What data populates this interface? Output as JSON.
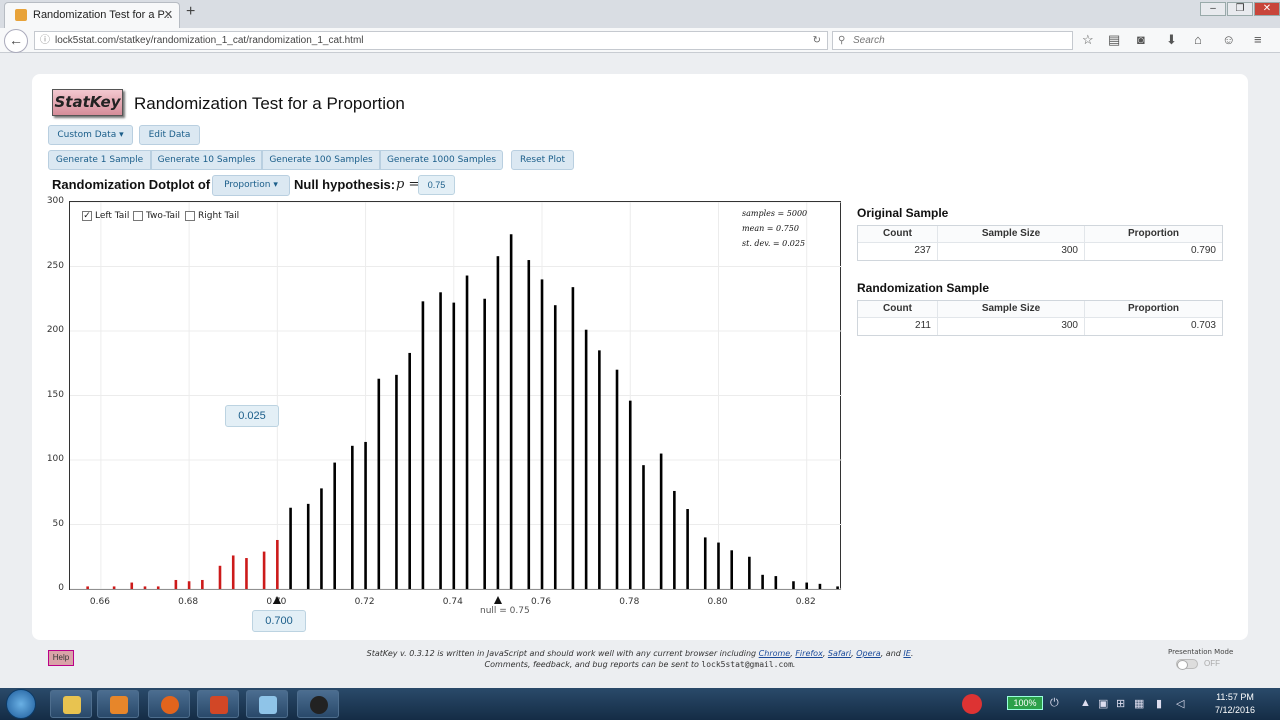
{
  "browser": {
    "tab_title": "Randomization Test for a P...",
    "url": "lock5stat.com/statkey/randomization_1_cat/randomization_1_cat.html",
    "search_placeholder": "Search"
  },
  "app": {
    "logo": "StatKey",
    "title": "Randomization Test for a Proportion"
  },
  "controls": {
    "custom_data": "Custom Data",
    "edit_data": "Edit Data",
    "gen1": "Generate 1 Sample",
    "gen10": "Generate 10 Samples",
    "gen100": "Generate 100 Samples",
    "gen1000": "Generate 1000 Samples",
    "reset": "Reset Plot",
    "dotplot_label": "Randomization Dotplot of",
    "statistic_select": "Proportion",
    "null_label": "Null hypothesis:",
    "null_symbol": "p =",
    "null_value": "0.75"
  },
  "plot": {
    "tail_options": [
      {
        "label": "Left Tail",
        "checked": true
      },
      {
        "label": "Two-Tail",
        "checked": false
      },
      {
        "label": "Right Tail",
        "checked": false
      }
    ],
    "stats": [
      "samples = 5000",
      "mean = 0.750",
      "st. dev. = 0.025"
    ],
    "tail_prop_label": "0.025",
    "cutoff_label": "0.700",
    "null_marker": "null = 0.75"
  },
  "chart_data": {
    "type": "bar",
    "xlim": [
      0.653,
      0.828
    ],
    "ylim": [
      0,
      300
    ],
    "x_ticks": [
      "0.66",
      "0.68",
      "0.70",
      "0.72",
      "0.74",
      "0.76",
      "0.78",
      "0.80",
      "0.82"
    ],
    "y_ticks": [
      "0",
      "50",
      "100",
      "150",
      "200",
      "250",
      "300"
    ],
    "cutoff": 0.7,
    "highlight_color": "#cc1a1a",
    "base_color": "#000000",
    "x": [
      0.657,
      0.663,
      0.667,
      0.67,
      0.673,
      0.677,
      0.68,
      0.683,
      0.687,
      0.69,
      0.693,
      0.697,
      0.7,
      0.703,
      0.707,
      0.71,
      0.713,
      0.717,
      0.72,
      0.723,
      0.727,
      0.73,
      0.733,
      0.737,
      0.74,
      0.743,
      0.747,
      0.75,
      0.753,
      0.757,
      0.76,
      0.763,
      0.767,
      0.77,
      0.773,
      0.777,
      0.78,
      0.783,
      0.787,
      0.79,
      0.793,
      0.797,
      0.8,
      0.803,
      0.807,
      0.81,
      0.813,
      0.817,
      0.82,
      0.823,
      0.827
    ],
    "values": [
      2,
      2,
      5,
      2,
      2,
      7,
      6,
      7,
      18,
      26,
      24,
      29,
      38,
      63,
      66,
      78,
      98,
      111,
      114,
      163,
      166,
      183,
      223,
      230,
      222,
      243,
      225,
      258,
      275,
      255,
      240,
      220,
      234,
      201,
      185,
      170,
      146,
      96,
      105,
      76,
      62,
      40,
      36,
      30,
      25,
      11,
      10,
      6,
      5,
      4,
      2
    ]
  },
  "original_sample": {
    "title": "Original Sample",
    "headers": [
      "Count",
      "Sample Size",
      "Proportion"
    ],
    "values": [
      "237",
      "300",
      "0.790"
    ]
  },
  "randomization_sample": {
    "title": "Randomization Sample",
    "headers": [
      "Count",
      "Sample Size",
      "Proportion"
    ],
    "values": [
      "211",
      "300",
      "0.703"
    ]
  },
  "footer": {
    "line1_prefix": "StatKey v. 0.3.12 is written in JavaScript and should work well with any current browser including",
    "browsers": [
      "Chrome",
      "Firefox",
      "Safari",
      "Opera",
      "IE"
    ],
    "line2_prefix": "Comments, feedback, and bug reports can be sent to",
    "email": "lock5stat@gmail.com",
    "help": "Help",
    "presentation_mode": "Presentation Mode",
    "off": "OFF"
  },
  "taskbar": {
    "battery": "100%",
    "time": "11:57 PM",
    "date": "7/12/2016"
  }
}
